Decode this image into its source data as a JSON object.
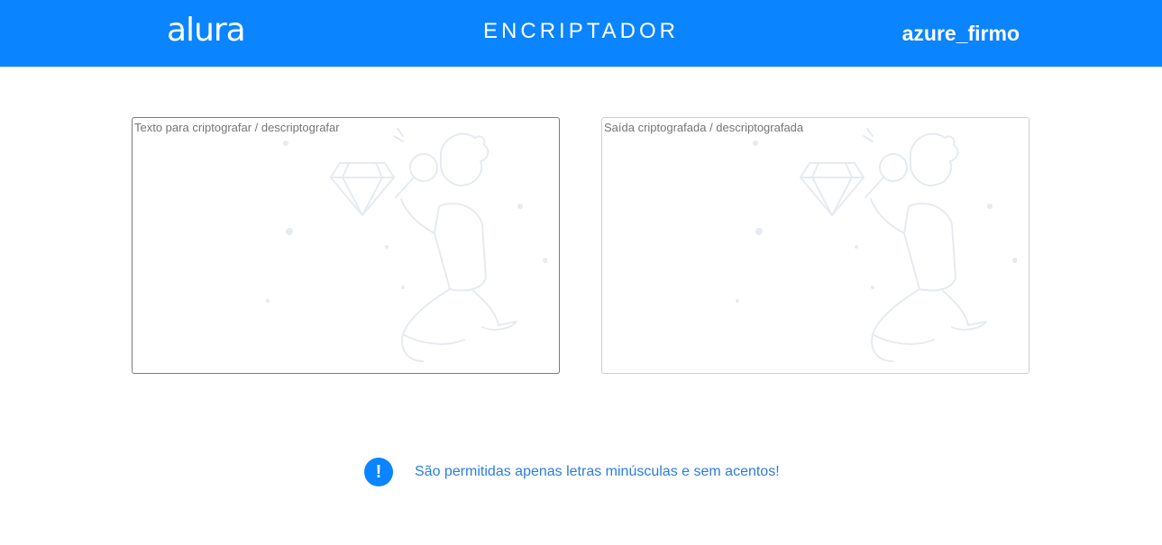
{
  "header": {
    "logo": "alura",
    "title": "ENCRIPTADOR",
    "username": "azure_firmo",
    "background_color": "#0a84ff"
  },
  "input_panel": {
    "placeholder": "Texto para criptografar / descriptografar",
    "value": "",
    "illustration": "person-with-magnifying-glass-and-diamond"
  },
  "output_panel": {
    "placeholder": "Saída criptografada / descriptografada",
    "value": "",
    "illustration": "person-with-magnifying-glass-and-diamond"
  },
  "notice": {
    "icon": "exclamation-icon",
    "text": "São permitidas apenas letras minúsculas e sem acentos!",
    "icon_color": "#0a84ff",
    "text_color": "#2b7de0"
  }
}
